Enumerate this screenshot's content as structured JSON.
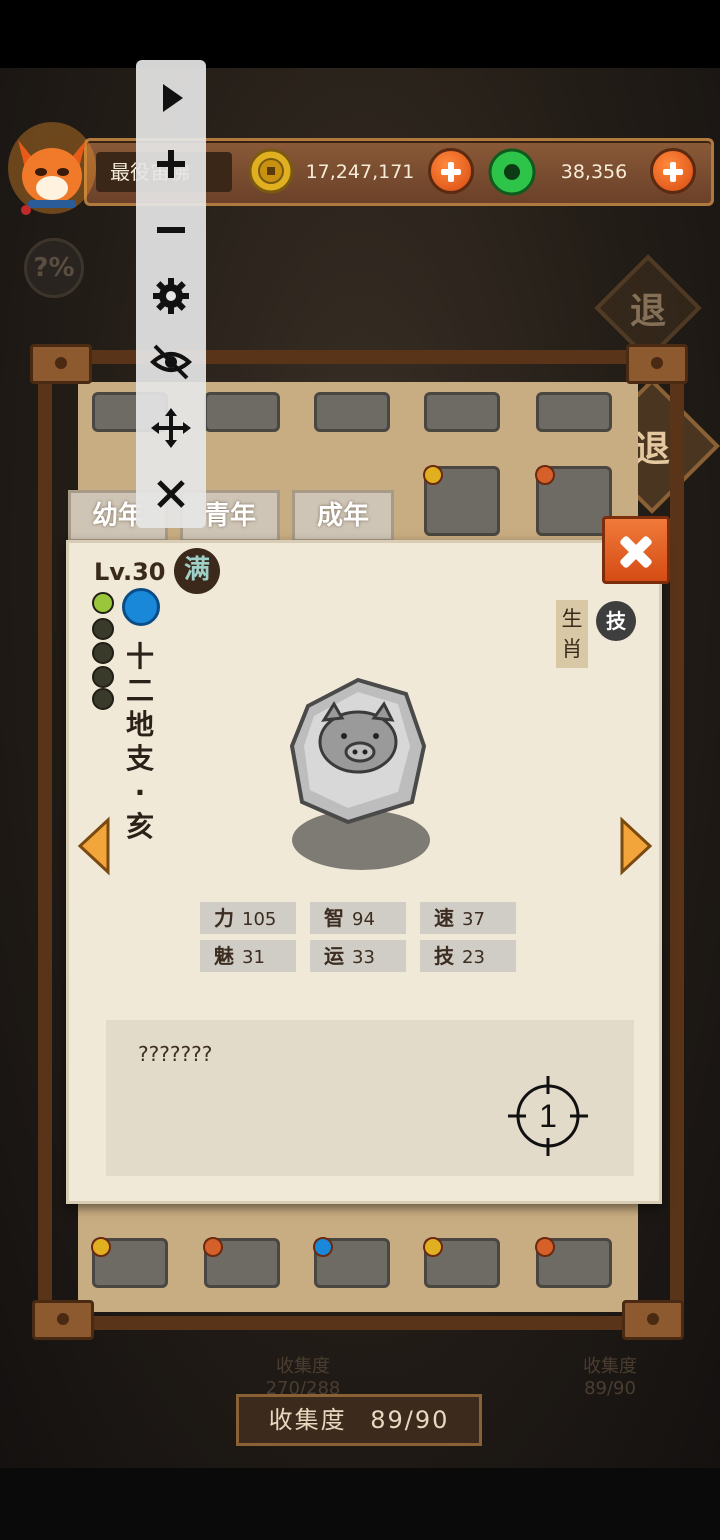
{
  "player": {
    "name": "最役宙佛"
  },
  "resources": {
    "coins": "17,247,171",
    "jade": "38,356"
  },
  "retreat_label": "退",
  "percent_badge": "?%",
  "tabs": [
    "幼年",
    "青年",
    "成年"
  ],
  "character": {
    "level": "Lv.30",
    "max_badge": "满",
    "name_chars": [
      "十",
      "二",
      "地",
      "支",
      "·",
      "亥"
    ],
    "zodiac_tag": "生肖",
    "skill_badge": "技",
    "growth_total": 5,
    "growth_active": 1,
    "element_icon": "water-drop-icon"
  },
  "stats": [
    {
      "name": "力",
      "value": "105"
    },
    {
      "name": "智",
      "value": "94"
    },
    {
      "name": "速",
      "value": "37"
    },
    {
      "name": "魅",
      "value": "31"
    },
    {
      "name": "运",
      "value": "33"
    },
    {
      "name": "技",
      "value": "23"
    }
  ],
  "description": "???????",
  "crosshair_label": "1",
  "collection": {
    "label": "收集度",
    "value": "89/90",
    "faded_left": "270/288",
    "faded_right": "89/90"
  },
  "toolbar": [
    "play-icon",
    "plus-icon",
    "minus-icon",
    "gear-icon",
    "eye-off-icon",
    "move-icon",
    "close-icon"
  ],
  "colors": {
    "accent_orange": "#e0561a",
    "parchment": "#f1e9d7",
    "wood": "#5a3418"
  }
}
